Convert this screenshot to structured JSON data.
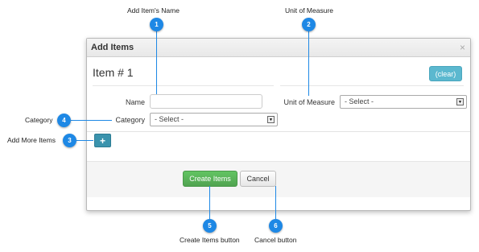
{
  "annotations": {
    "item_name": {
      "number": "1",
      "label": "Add Item's Name"
    },
    "unit_of_measure": {
      "number": "2",
      "label": "Unit of Measure"
    },
    "add_more_items": {
      "number": "3",
      "label": "Add More Items"
    },
    "category": {
      "number": "4",
      "label": "Category"
    },
    "create_items": {
      "number": "5",
      "label": "Create Items button"
    },
    "cancel": {
      "number": "6",
      "label": "Cancel button"
    }
  },
  "dialog": {
    "title": "Add Items",
    "close_glyph": "×",
    "item_heading": "Item # 1",
    "clear_label": "(clear)",
    "name_label": "Name",
    "name_value": "",
    "unit_label": "Unit of Measure",
    "unit_selected": "- Select -",
    "category_label": "Category",
    "category_selected": "- Select -",
    "add_more_label": "+",
    "create_label": "Create Items",
    "cancel_label": "Cancel"
  },
  "colors": {
    "annotation_blue": "#1e88e5",
    "create_green": "#5cb85c",
    "clear_cyan": "#5bc0de",
    "add_teal": "#3a93ad"
  },
  "icons": {
    "select_arrow": "triangle-down-icon",
    "close": "close-icon"
  }
}
